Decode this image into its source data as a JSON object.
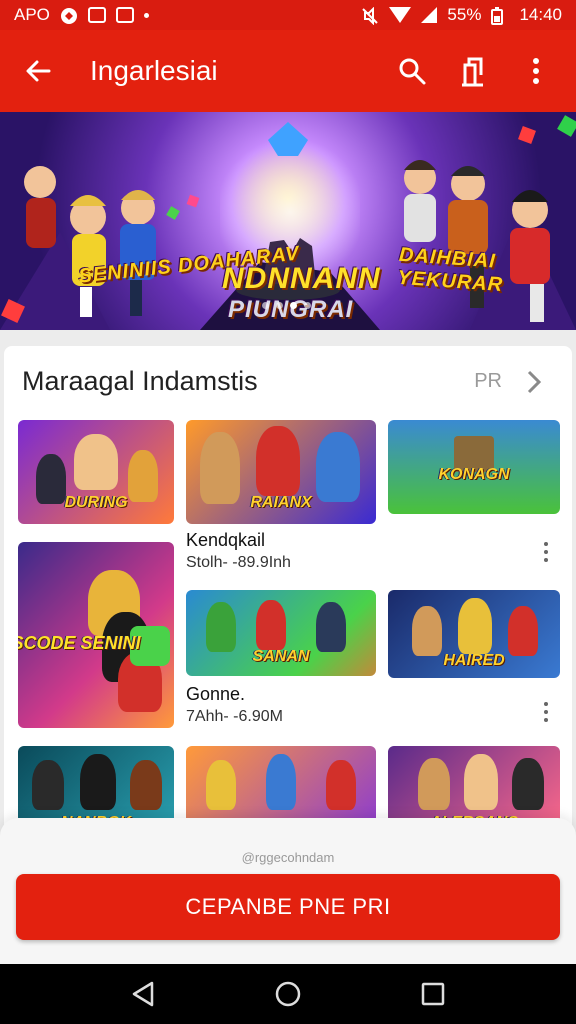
{
  "status_bar": {
    "left_text": "APO",
    "battery_text": "55%",
    "time": "14:40",
    "icons": [
      "app-notification-icon",
      "inbox-icon",
      "n-app-icon",
      "mute-icon",
      "wifi-icon",
      "signal-icon",
      "battery-icon"
    ]
  },
  "app_bar": {
    "title": "Ingarlesiai",
    "icons": [
      "back-arrow-icon",
      "search-icon",
      "share-icon",
      "more-vert-icon"
    ]
  },
  "banner": {
    "left_title": "SENINIIS DOAHARAV",
    "center_title": "NDNNANN",
    "center_subtitle": "PIUNGRAI",
    "right_title": "DAIHBIAI YEKURAR",
    "page_count": 4,
    "active_page": 3
  },
  "section": {
    "title": "Maraagal Indamstis",
    "link": "PR"
  },
  "tiles": [
    {
      "label": "DURING"
    },
    {
      "label": "RAIANX"
    },
    {
      "label": "KONAGN"
    },
    {
      "label": "SCODE SENINI"
    },
    {
      "label": "SANAN"
    },
    {
      "label": "HAIRED"
    },
    {
      "label": "NANBOK"
    },
    {
      "label": ""
    },
    {
      "label": "ALERSANS"
    }
  ],
  "items": [
    {
      "title": "Kendqkail",
      "subtitle": "Stolh- -89.9Inh"
    },
    {
      "title": "Gonne.",
      "subtitle": "7Ahh- -6.90M"
    }
  ],
  "sheet": {
    "caption": "@rggecohndam",
    "button_label": "CEPANBE PNE PRI"
  },
  "colors": {
    "primary": "#e3210f",
    "status": "#d91c10",
    "card": "#ffffff"
  }
}
